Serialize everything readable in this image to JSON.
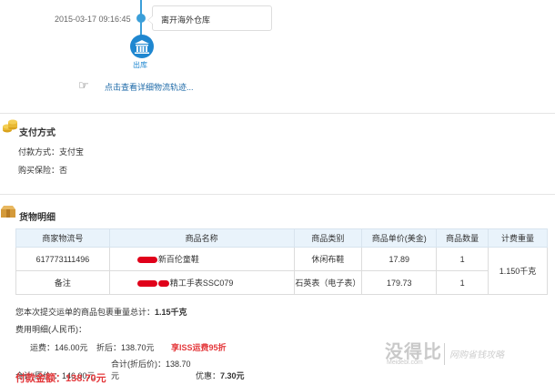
{
  "timeline": {
    "time": "2015-03-17 09:16:45",
    "event": "离开海外仓库",
    "status_label": "出库",
    "hand_glyph": "☞",
    "track_link": "点击查看详细物流轨迹..."
  },
  "payment": {
    "title": "支付方式",
    "method": "付款方式：支付宝",
    "insurance": "购买保险：否"
  },
  "goods": {
    "title": "货物明细",
    "headers": [
      "商家物流号",
      "商品名称",
      "商品类别",
      "商品单价(美金)",
      "商品数量",
      "计费重量"
    ],
    "tracking_no": "617773111496",
    "remark_label": "备注",
    "weight": "1.150千克",
    "rows": [
      {
        "name": "新百伦童鞋",
        "category": "休闲布鞋",
        "price": "17.89",
        "qty": "1"
      },
      {
        "name": "精工手表SSC079",
        "category": "石英表（电子表）",
        "price": "179.73",
        "qty": "1"
      }
    ]
  },
  "summary": {
    "weight_text": "您本次提交运单的商品包裹重量总计：",
    "weight_value": "1.15千克",
    "fee_title": "费用明细(人民币)：",
    "freight": "运费：146.00元",
    "after_discount": "折后：138.70元",
    "promo": "享ISS运费95折",
    "total_orig": "合计(原价)：146.00元",
    "total_discounted": "合计(折后价)：138.70元",
    "discount_label": "优惠：",
    "discount_value": "7.30元",
    "pay_label": "付款金额：",
    "pay_value": "138.70元"
  },
  "watermark": {
    "main": "没得比",
    "sub": "Meidebi.com",
    "slogan": "网购省钱攻略"
  },
  "colors": {
    "accent_blue": "#3b9fd9",
    "link_blue": "#1e6aa8",
    "price_red": "#e4393c"
  }
}
